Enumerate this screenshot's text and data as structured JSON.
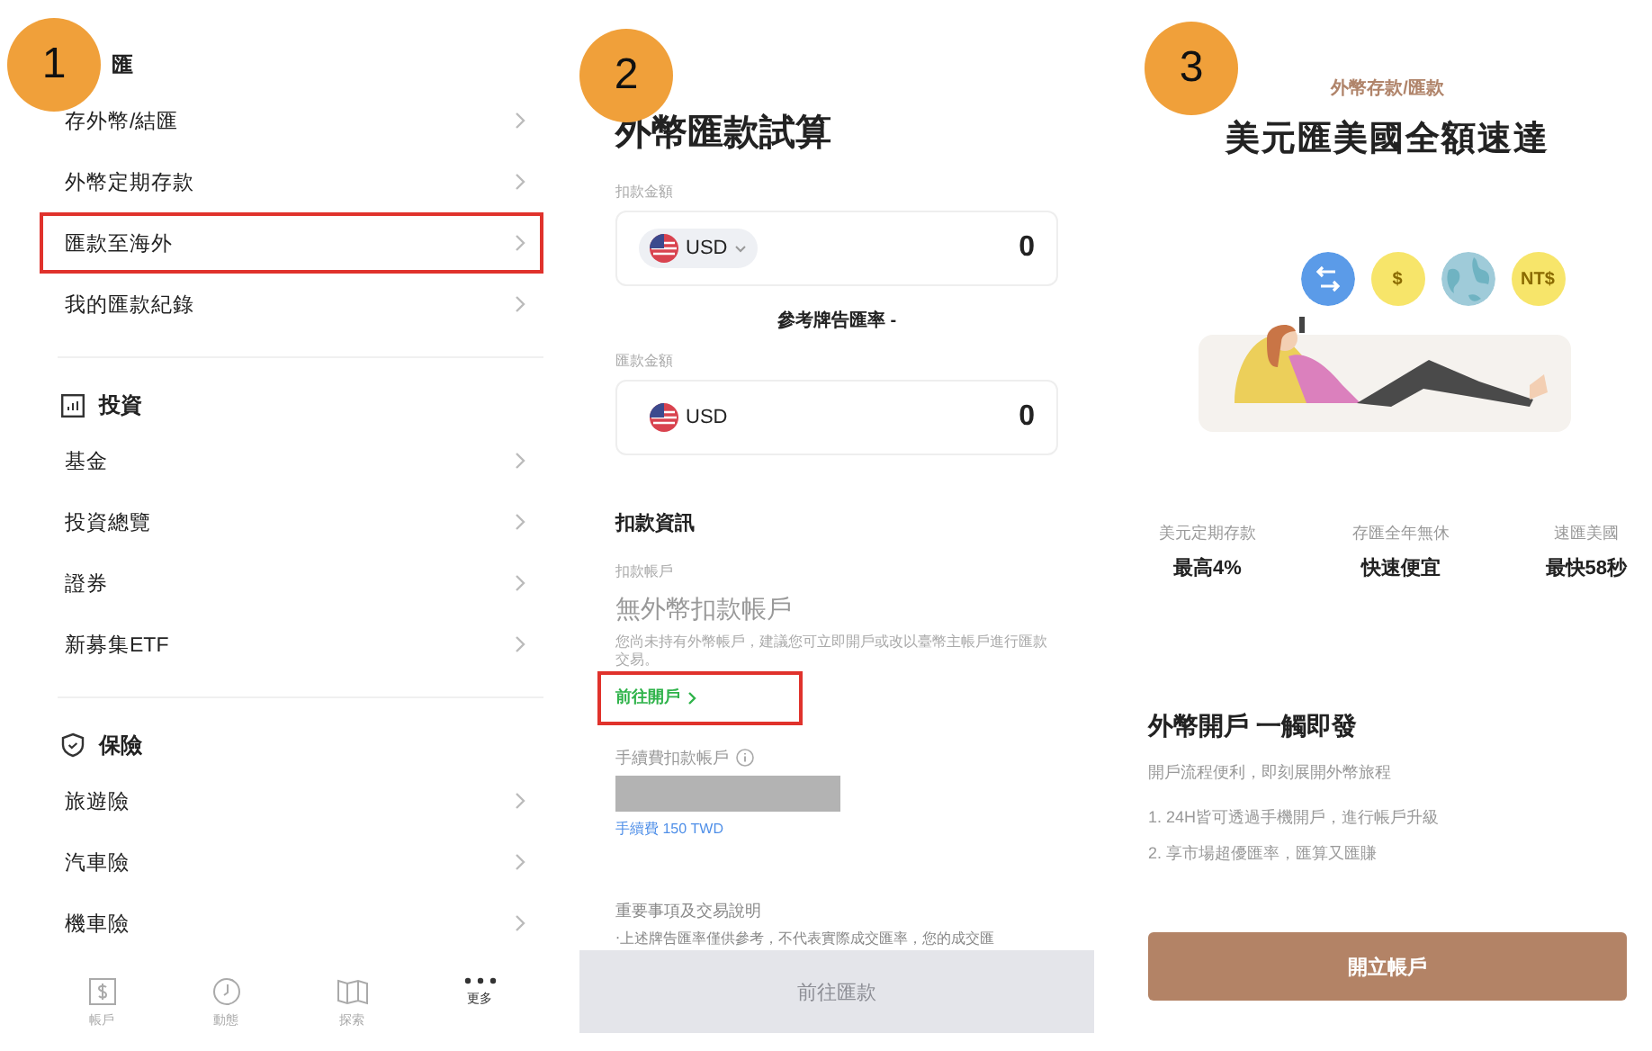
{
  "steps": [
    "1",
    "2",
    "3"
  ],
  "menu_screen": {
    "sections": [
      {
        "title": "匯",
        "items": [
          {
            "label": "存外幣/結匯",
            "highlighted": false
          },
          {
            "label": "外幣定期存款",
            "highlighted": false
          },
          {
            "label": "匯款至海外",
            "highlighted": true
          },
          {
            "label": "我的匯款紀錄",
            "highlighted": false
          }
        ]
      },
      {
        "title": "投資",
        "kind": "chart",
        "items": [
          {
            "label": "基金",
            "highlighted": false
          },
          {
            "label": "投資總覽",
            "highlighted": false
          },
          {
            "label": "證券",
            "highlighted": false
          },
          {
            "label": "新募集ETF",
            "highlighted": false
          }
        ]
      },
      {
        "title": "保險",
        "kind": "shield",
        "items": [
          {
            "label": "旅遊險",
            "highlighted": false
          },
          {
            "label": "汽車險",
            "highlighted": false
          },
          {
            "label": "機車險",
            "highlighted": false
          }
        ]
      }
    ],
    "tab_bar": [
      {
        "label": "帳戶",
        "kind": "dollar",
        "selected": false
      },
      {
        "label": "動態",
        "kind": "clock",
        "selected": false
      },
      {
        "label": "探索",
        "kind": "map",
        "selected": false
      },
      {
        "label": "更多",
        "kind": "dots",
        "selected": true
      }
    ]
  },
  "calculator_screen": {
    "title": "外幣匯款試算",
    "debit_label": "扣款金額",
    "debit_currency": "USD",
    "debit_amount": "0",
    "rate_text": "參考牌告匯率 -",
    "remit_label": "匯款金額",
    "remit_currency": "USD",
    "remit_amount": "0",
    "section_title": "扣款資訊",
    "account_label": "扣款帳戶",
    "account_value": "無外幣扣款帳戶",
    "account_note": "您尚未持有外幣帳戶，建議您可立即開戶或改以臺幣主帳戶進行匯款交易。",
    "open_link": {
      "label": "前往開戶",
      "highlighted": true
    },
    "fee_account_label": "手續費扣款帳戶",
    "fee_text": "手續費 150 TWD",
    "notes_title": "重要事項及交易說明",
    "notes_line": "‧上述牌告匯率僅供參考，不代表實際成交匯率，您的成交匯",
    "submit_button": {
      "label": "前往匯款",
      "disabled": true
    }
  },
  "promo_screen": {
    "category": "外幣存款/匯款",
    "title": "美元匯美國全額速達",
    "coins": [
      {
        "kind": "exchange",
        "color": "#5b9be8"
      },
      {
        "kind": "text",
        "label": "$",
        "color": "#f7e56a"
      },
      {
        "kind": "globe",
        "color": "#9fcbd9"
      },
      {
        "kind": "text",
        "label": "NT$",
        "color": "#f7e56a"
      }
    ],
    "features": [
      {
        "caption": "美元定期存款",
        "value": "最高4%"
      },
      {
        "caption": "存匯全年無休",
        "value": "快速便宜"
      },
      {
        "caption": "速匯美國",
        "value": "最快58秒"
      }
    ],
    "section_title": "外幣開戶 一觸即發",
    "subtitle": "開戶流程便利，即刻展開外幣旅程",
    "points": [
      "1. 24H皆可透過手機開戶，進行帳戶升級",
      "2. 享市場超優匯率，匯算又匯賺"
    ],
    "cta": "開立帳戶"
  }
}
